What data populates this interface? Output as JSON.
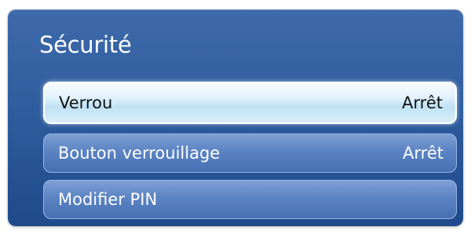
{
  "menu": {
    "title": "Sécurité",
    "items": [
      {
        "label": "Verrou",
        "value": "Arrêt"
      },
      {
        "label": "Bouton verrouillage",
        "value": "Arrêt"
      },
      {
        "label": "Modifier PIN",
        "value": ""
      }
    ]
  },
  "colors": {
    "panel_bg": "#2f5d9f",
    "focused_item_bg": "#d8eef9",
    "item_bg": "#5c84c3",
    "text_light": "#ffffff",
    "text_dark": "#111111"
  }
}
